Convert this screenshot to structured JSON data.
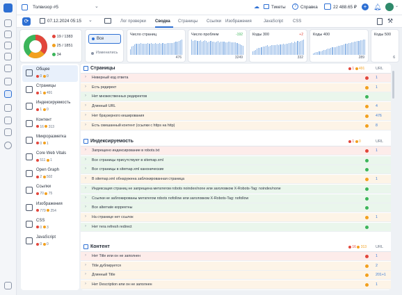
{
  "top": {
    "project": "Толвизор #5",
    "tickets": "Тикеты",
    "help": "Справка",
    "balance": "22 488.65 ₽",
    "lang": "RU"
  },
  "toolbar": {
    "date": "07.12.2024 05:15",
    "tabs": [
      {
        "label": "Лог проверки",
        "active": false
      },
      {
        "label": "Сводка",
        "active": true
      },
      {
        "label": "Страницы",
        "active": false
      },
      {
        "label": "Ссылки",
        "active": false
      },
      {
        "label": "Изображения",
        "active": false
      },
      {
        "label": "JavaScript",
        "active": false
      },
      {
        "label": "CSS",
        "active": false
      }
    ]
  },
  "summary": {
    "red": "19 / 1383",
    "orange": "25 / 1851",
    "green": "34",
    "pie": {
      "red": 36,
      "orange": 24,
      "green": 40
    }
  },
  "filters": {
    "all": "Все",
    "changed": "Изменились"
  },
  "cards": [
    {
      "title": "Число страниц",
      "delta": "",
      "value": "476",
      "bars": [
        30,
        45,
        50,
        55,
        58,
        60,
        60,
        62,
        60,
        58,
        61,
        60,
        63,
        60,
        62,
        58,
        60,
        62,
        60,
        61,
        63,
        60,
        62,
        61,
        60,
        62,
        64,
        63,
        65,
        64,
        66,
        70,
        72,
        74,
        78,
        82
      ]
    },
    {
      "title": "Число проблем",
      "delta": "-192",
      "value": "3249",
      "bars": [
        60,
        55,
        58,
        56,
        54,
        55,
        57,
        52,
        55,
        56,
        54,
        50,
        52,
        55,
        53,
        51,
        50,
        52,
        54,
        50,
        51,
        53,
        52,
        50,
        48,
        51,
        52,
        50,
        49,
        50,
        48,
        46,
        45,
        40,
        38,
        36
      ]
    },
    {
      "title": "Коды 300",
      "delta": "+2",
      "value": "332",
      "bars": [
        20,
        25,
        30,
        35,
        40,
        42,
        45,
        50,
        48,
        52,
        55,
        50,
        54,
        56,
        55,
        58,
        57,
        60,
        58,
        62,
        60,
        64,
        62,
        66,
        65,
        70,
        68,
        72,
        70,
        75,
        74,
        80,
        78,
        82,
        84,
        88
      ]
    },
    {
      "title": "Коды 400",
      "delta": "",
      "value": "289",
      "bars": [
        10,
        12,
        15,
        18,
        20,
        22,
        25,
        28,
        30,
        33,
        36,
        38,
        40,
        44,
        46,
        48,
        50,
        54,
        56,
        58,
        60,
        62,
        65,
        67,
        70,
        72,
        74,
        76,
        78,
        80,
        82,
        84,
        86,
        88,
        90,
        92
      ]
    },
    {
      "title": "Коды 500",
      "delta": "",
      "value": "6",
      "bars": [
        40,
        0,
        0,
        0,
        0,
        0,
        0,
        0,
        0,
        0,
        0,
        0,
        0,
        0,
        0,
        0,
        0,
        0,
        0,
        0,
        0,
        0,
        0,
        0,
        0,
        0,
        0,
        0,
        0,
        0,
        0,
        0,
        0,
        0,
        0,
        10
      ]
    }
  ],
  "categories": [
    {
      "name": "Общее",
      "c1": "0",
      "c2": "0",
      "icon": "grid-icon",
      "active": true
    },
    {
      "name": "Страницы",
      "c1": "1",
      "c2": "491",
      "icon": "page-icon",
      "active": false
    },
    {
      "name": "Индексируемость",
      "c1": "1",
      "c2": "0",
      "icon": "magnifier-icon",
      "active": false
    },
    {
      "name": "Контент",
      "c1": "16",
      "c2": "313",
      "icon": "content-icon",
      "active": false
    },
    {
      "name": "Микроразметка",
      "c1": "0",
      "c2": "1",
      "icon": "markup-icon",
      "active": false
    },
    {
      "name": "Core Web Vitals",
      "c1": "511",
      "c2": "1",
      "icon": "vitals-icon",
      "active": false
    },
    {
      "name": "Open Graph",
      "c1": "2",
      "c2": "502",
      "icon": "opengraph-icon",
      "active": false
    },
    {
      "name": "Ссылки",
      "c1": "70",
      "c2": "75",
      "icon": "links-icon",
      "active": false
    },
    {
      "name": "Изображения",
      "c1": "779",
      "c2": "254",
      "icon": "image-icon",
      "active": false
    },
    {
      "name": "CSS",
      "c1": "0",
      "c2": "3",
      "icon": "css-icon",
      "active": false
    },
    {
      "name": "JavaScript",
      "c1": "0",
      "c2": "0",
      "icon": "js-icon",
      "active": false
    }
  ],
  "sections": [
    {
      "title": "Страницы",
      "red": "1",
      "orange": "491",
      "url": "URL",
      "rows": [
        {
          "label": "Неверный код ответа",
          "status": "red",
          "value": "1"
        },
        {
          "label": "Есть редирект",
          "status": "orange",
          "value": "1"
        },
        {
          "label": "Нет множественных редиректов",
          "status": "green",
          "value": ""
        },
        {
          "label": "Длинный URL",
          "status": "orange",
          "value": "4"
        },
        {
          "label": "Нет браузерного кеширования",
          "status": "orange",
          "value": "476"
        },
        {
          "label": "Есть смешанный контент (ссылки с https на http)",
          "status": "orange",
          "value": "8"
        }
      ]
    },
    {
      "title": "Индексируемость",
      "red": "1",
      "orange": "0",
      "url": "URL",
      "rows": [
        {
          "label": "Запрещено индексирование в robots.txt",
          "status": "red",
          "value": "1"
        },
        {
          "label": "Все страницы присутствуют в sitemap.xml",
          "status": "green",
          "value": ""
        },
        {
          "label": "Все страницы в sitemap.xml канонические",
          "status": "green",
          "value": ""
        },
        {
          "label": "В sitemap.xml обнаружена заблокированная страница",
          "status": "orange",
          "value": "1"
        },
        {
          "label": "Индексация страниц не запрещена метатегом robots noindex/none или заголовком X-Robots-Tag: noindex/none",
          "status": "green",
          "value": ""
        },
        {
          "label": "Ссылки не заблокированы метатегом robots nofollow или заголовком X-Robots-Tag: nofollow",
          "status": "green",
          "value": ""
        },
        {
          "label": "Все alternate корректны",
          "status": "green",
          "value": ""
        },
        {
          "label": "На странице нет ссылок",
          "status": "orange",
          "value": "1"
        },
        {
          "label": "Нет тега refresh redirect",
          "status": "green",
          "value": ""
        }
      ]
    },
    {
      "title": "Контент",
      "red": "16",
      "orange": "313",
      "url": "URL",
      "rows": [
        {
          "label": "Нет Title или он не заполнен",
          "status": "red",
          "value": "1"
        },
        {
          "label": "Title дублируется",
          "status": "orange",
          "value": "2"
        },
        {
          "label": "Длинный Title",
          "status": "orange",
          "value": "201+1"
        },
        {
          "label": "Нет Description или он не заполнен",
          "status": "orange",
          "value": "1"
        }
      ]
    }
  ]
}
